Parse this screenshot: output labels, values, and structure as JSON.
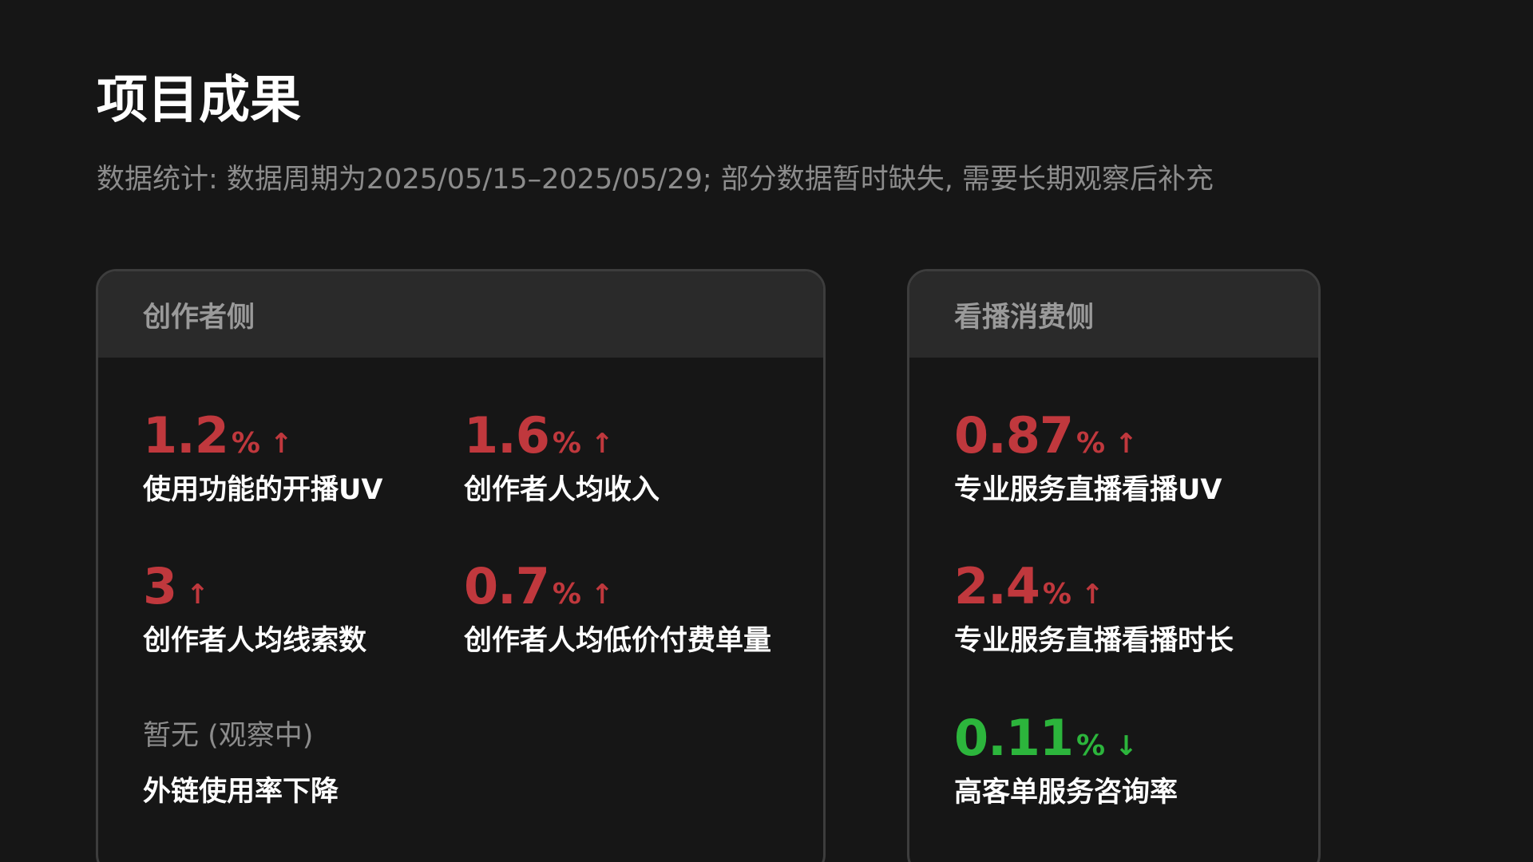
{
  "page": {
    "title": "项目成果",
    "subtitle": "数据统计: 数据周期为2025/05/15–2025/05/29; 部分数据暂时缺失, 需要长期观察后补充"
  },
  "colors": {
    "increase": "#c0383d",
    "decrease": "#2cb53c",
    "background": "#161616",
    "card_header": "#2a2a2a"
  },
  "creator_card": {
    "header": "创作者侧",
    "metrics": [
      {
        "value": "1.2",
        "unit": "%",
        "trend": "↑",
        "label": "使用功能的开播UV"
      },
      {
        "value": "1.6",
        "unit": "%",
        "trend": "↑",
        "label": "创作者人均收入"
      },
      {
        "value": "3",
        "unit": "",
        "trend": "↑",
        "label": "创作者人均线索数"
      },
      {
        "value": "0.7",
        "unit": "%",
        "trend": "↑",
        "label": "创作者人均低价付费单量"
      },
      {
        "pending": "暂无 (观察中)",
        "label": "外链使用率下降"
      }
    ]
  },
  "viewer_card": {
    "header": "看播消费侧",
    "metrics": [
      {
        "value": "0.87",
        "unit": "%",
        "trend": "↑",
        "label": "专业服务直播看播UV"
      },
      {
        "value": "2.4",
        "unit": "%",
        "trend": "↑",
        "label": "专业服务直播看播时长"
      },
      {
        "value": "0.11",
        "unit": "%",
        "trend": "↓",
        "label": "高客单服务咨询率"
      }
    ]
  }
}
